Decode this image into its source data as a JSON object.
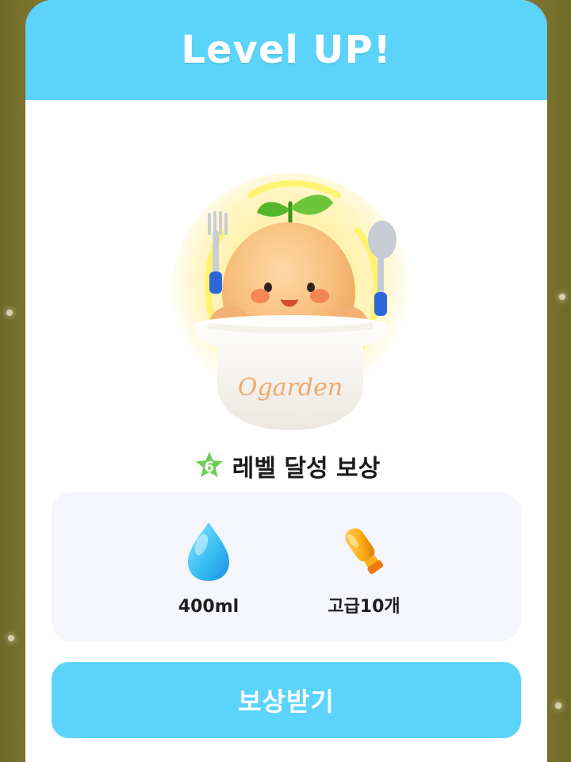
{
  "modal": {
    "title": "Level UP!"
  },
  "hero": {
    "brand_text": "Ogarden"
  },
  "level_reward": {
    "level": "6",
    "label": "레벨 달성 보상"
  },
  "rewards": [
    {
      "icon": "water-drop-icon",
      "label": "400ml"
    },
    {
      "icon": "fertilizer-bottle-icon",
      "label": "고급10개"
    }
  ],
  "buttons": {
    "claim_label": "보상받기"
  },
  "colors": {
    "accent": "#5bd3fb",
    "badge_green": "#6bcf57",
    "reward_panel": "#f4f6fb",
    "text_primary": "#1f1f1f"
  }
}
